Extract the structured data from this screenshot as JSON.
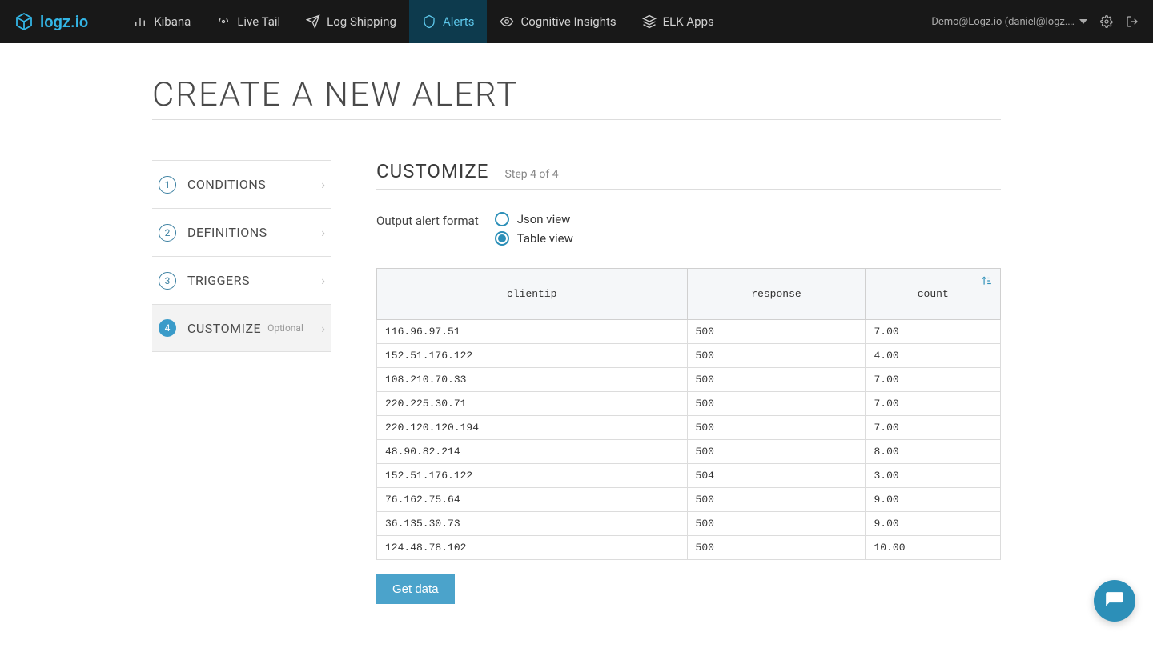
{
  "brand": "logz.io",
  "nav": {
    "kibana": "Kibana",
    "live_tail": "Live Tail",
    "log_shipping": "Log Shipping",
    "alerts": "Alerts",
    "cognitive": "Cognitive Insights",
    "elk_apps": "ELK Apps"
  },
  "user_label": "Demo@Logz.io (daniel@logz.…",
  "page_title": "CREATE A NEW ALERT",
  "steps": {
    "conditions": "CONDITIONS",
    "definitions": "DEFINITIONS",
    "triggers": "TRIGGERS",
    "customize": "CUSTOMIZE",
    "optional": "Optional"
  },
  "section": {
    "title": "CUSTOMIZE",
    "sub": "Step 4 of 4"
  },
  "format": {
    "label": "Output alert format",
    "json": "Json view",
    "table": "Table view"
  },
  "table": {
    "headers": {
      "clientip": "clientip",
      "response": "response",
      "count": "count"
    },
    "rows": [
      {
        "clientip": "116.96.97.51",
        "response": "500",
        "count": "7.00"
      },
      {
        "clientip": "152.51.176.122",
        "response": "500",
        "count": "4.00"
      },
      {
        "clientip": "108.210.70.33",
        "response": "500",
        "count": "7.00"
      },
      {
        "clientip": "220.225.30.71",
        "response": "500",
        "count": "7.00"
      },
      {
        "clientip": "220.120.120.194",
        "response": "500",
        "count": "7.00"
      },
      {
        "clientip": "48.90.82.214",
        "response": "500",
        "count": "8.00"
      },
      {
        "clientip": "152.51.176.122",
        "response": "504",
        "count": "3.00"
      },
      {
        "clientip": "76.162.75.64",
        "response": "500",
        "count": "9.00"
      },
      {
        "clientip": "36.135.30.73",
        "response": "500",
        "count": "9.00"
      },
      {
        "clientip": "124.48.78.102",
        "response": "500",
        "count": "10.00"
      }
    ]
  },
  "get_data": "Get data"
}
